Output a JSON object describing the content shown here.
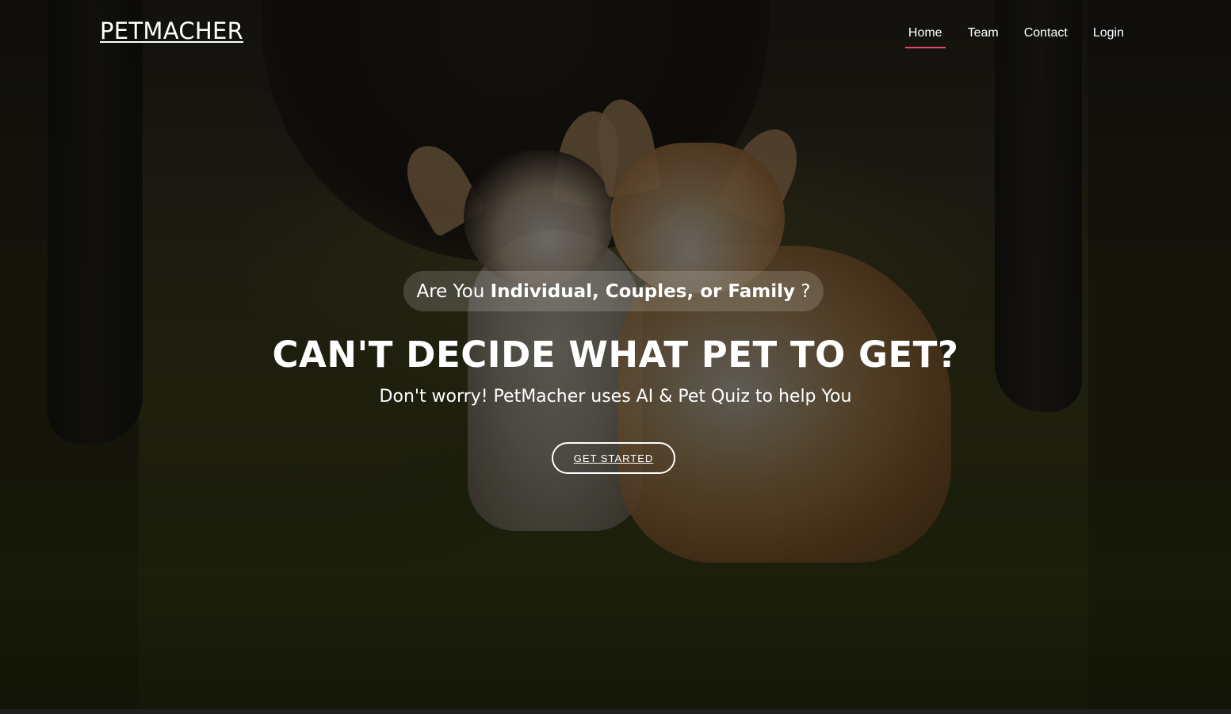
{
  "header": {
    "logo": "PETMACHER",
    "nav": [
      {
        "label": "Home",
        "active": true
      },
      {
        "label": "Team",
        "active": false
      },
      {
        "label": "Contact",
        "active": false
      },
      {
        "label": "Login",
        "active": false
      }
    ]
  },
  "hero": {
    "pill_prefix": "Are You",
    "pill_bold": "Individual, Couples, or Family",
    "pill_suffix": "?",
    "headline": "CAN'T DECIDE WHAT PET TO GET?",
    "subline": "Don't worry! PetMacher uses AI & Pet Quiz to help You",
    "cta_label": "GET STARTED",
    "background_image": "two-corgis-in-forest"
  },
  "colors": {
    "accent": "#e8416f",
    "text": "#ffffff"
  }
}
